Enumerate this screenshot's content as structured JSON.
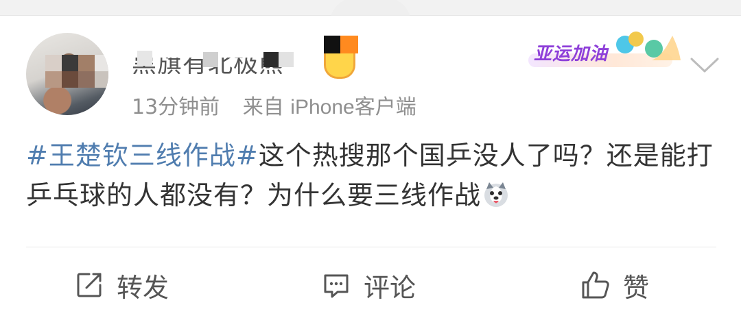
{
  "post": {
    "author": {
      "name": "黑旗有北极熊",
      "avatar_icon": "avatar-photo-icon",
      "badge_icon": "vip-badge-icon"
    },
    "meta": {
      "time": "13分钟前",
      "source_prefix": "来自",
      "client": "iPhone客户端"
    },
    "campaign_badge": {
      "text": "亚运加油",
      "color": "#8e3fd9"
    },
    "menu_icon": "chevron-down-icon",
    "content": {
      "hashtag": "#王楚钦三线作战#",
      "text": "这个热搜那个国乒没人了吗？还是能打乒乓球的人都没有？为什么要三线作战",
      "emoji_icon": "husky-emoji-icon"
    }
  },
  "actions": {
    "repost_label": "转发",
    "comment_label": "评论",
    "like_label": "赞"
  },
  "colors": {
    "hashtag": "#507daf",
    "text": "#333333",
    "meta": "#8f8f8f"
  }
}
